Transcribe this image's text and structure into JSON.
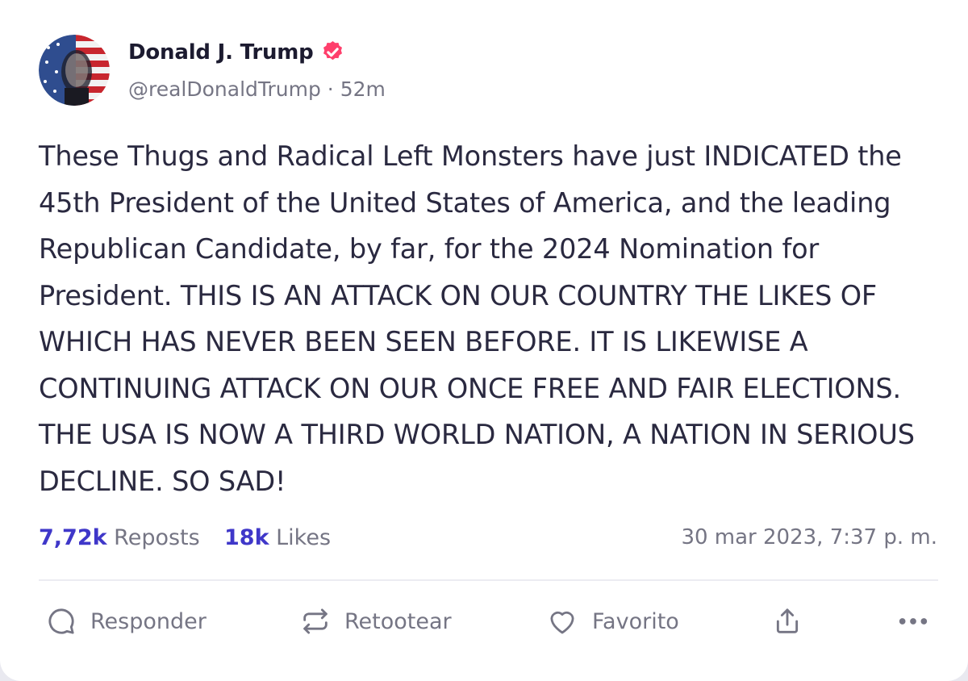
{
  "post": {
    "author": {
      "display_name": "Donald J. Trump",
      "handle": "@realDonaldTrump",
      "separator": "·",
      "time_ago": "52m",
      "verified_color": "#ff3f6c"
    },
    "text": "These Thugs and Radical Left Monsters have just INDICATED the 45th President of the United States of America, and the leading Republican Candidate, by far, for the 2024 Nomination for President. THIS IS AN ATTACK ON OUR COUNTRY THE LIKES OF WHICH HAS NEVER BEEN SEEN BEFORE. IT IS LIKEWISE A CONTINUING ATTACK ON OUR ONCE FREE AND FAIR ELECTIONS. THE USA IS NOW A THIRD WORLD NATION, A NATION IN SERIOUS DECLINE. SO SAD!",
    "stats": {
      "reposts_count": "7,72k",
      "reposts_label": "Reposts",
      "likes_count": "18k",
      "likes_label": "Likes"
    },
    "timestamp": "30 mar 2023, 7:37 p. m."
  },
  "actions": {
    "reply_label": "Responder",
    "repost_label": "Retootear",
    "favorite_label": "Favorito",
    "share_icon": "share-icon",
    "more_icon": "more-icon"
  },
  "colors": {
    "accent": "#3f37c9",
    "muted": "#757584",
    "text": "#2a2940"
  }
}
